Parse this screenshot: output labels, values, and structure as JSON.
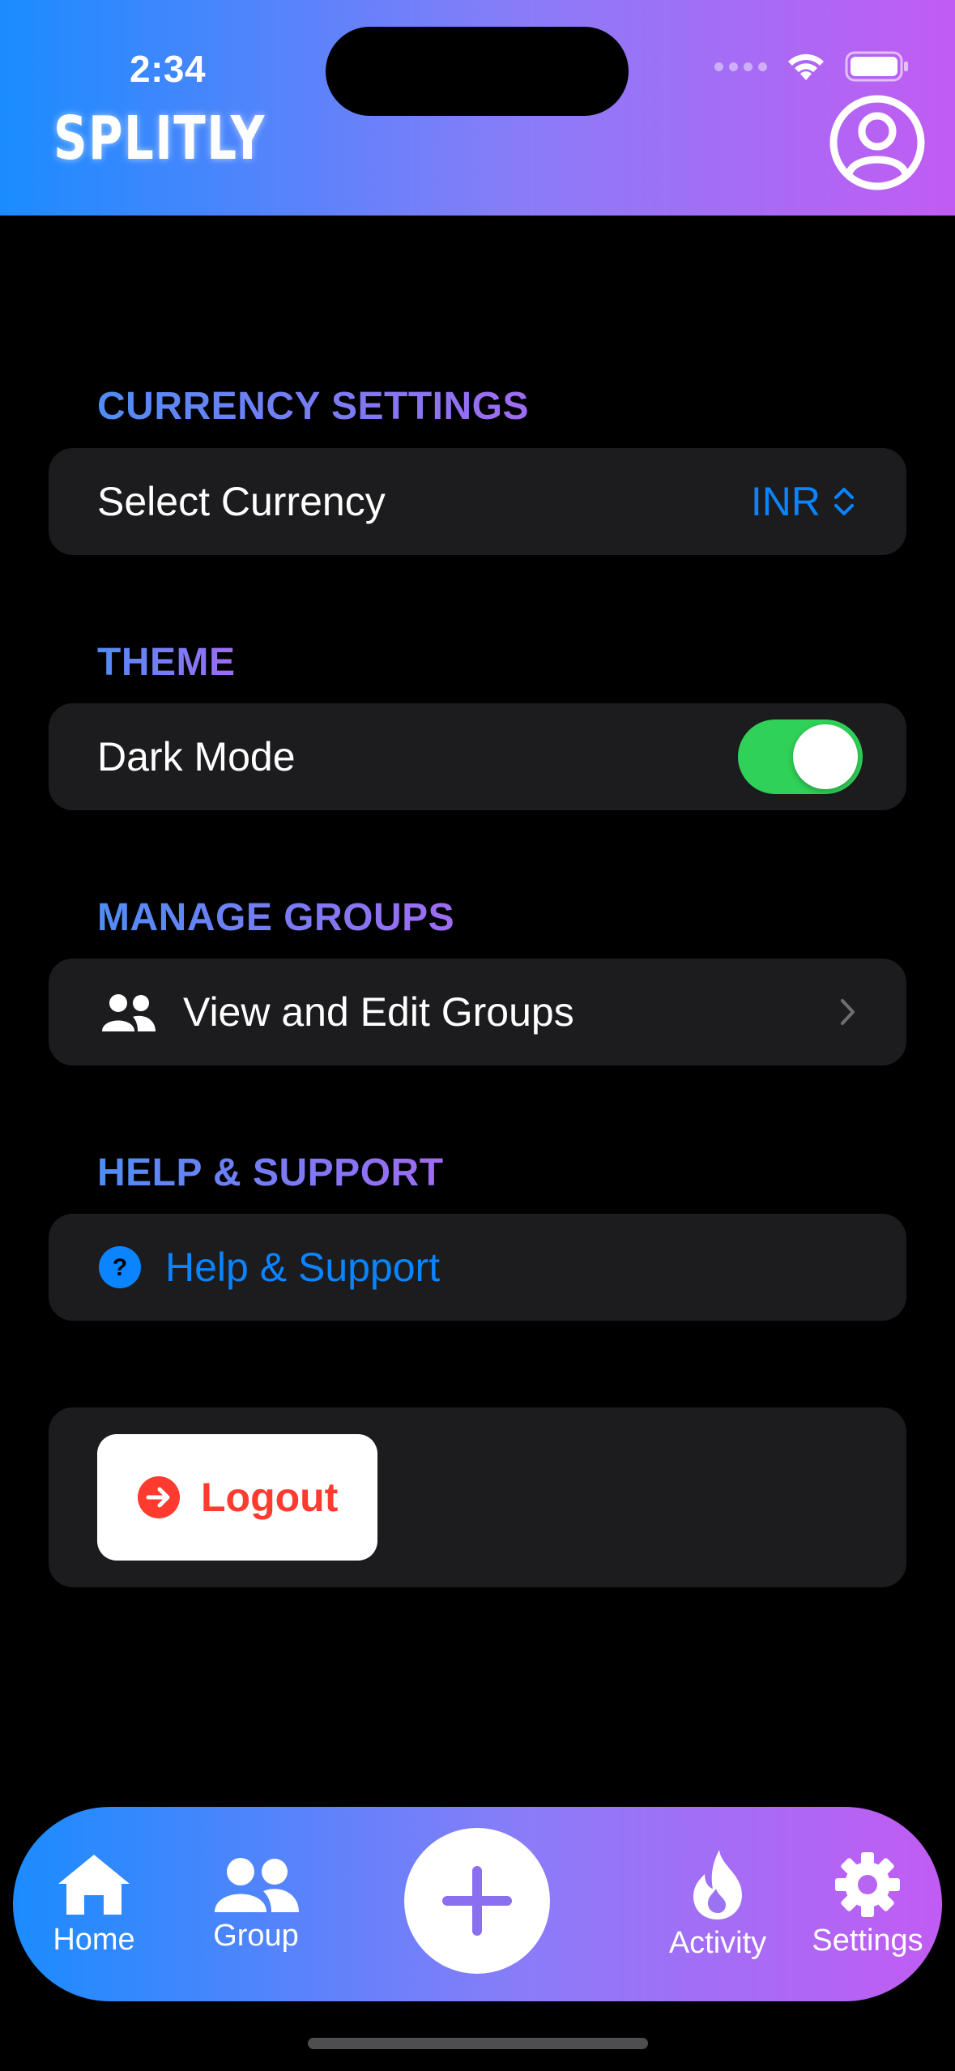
{
  "status_bar": {
    "time": "2:34"
  },
  "header": {
    "app_title": "SPLITLY",
    "profile_icon": "person-circle-icon"
  },
  "sections": {
    "currency": {
      "title": "CURRENCY SETTINGS",
      "row_label": "Select Currency",
      "selected_value": "INR",
      "icon": "chevron-up-down-icon"
    },
    "theme": {
      "title": "THEME",
      "row_label": "Dark Mode",
      "toggle_on": true
    },
    "groups": {
      "title": "MANAGE GROUPS",
      "row_label": "View and Edit Groups",
      "icon": "people-icon"
    },
    "help": {
      "title": "HELP & SUPPORT",
      "row_label": "Help & Support",
      "icon": "question-circle-icon"
    },
    "logout": {
      "label": "Logout",
      "icon": "arrow-right-circle-icon"
    }
  },
  "tabbar": {
    "items": [
      {
        "label": "Home",
        "icon": "house-icon"
      },
      {
        "label": "Group",
        "icon": "people-icon"
      },
      {
        "label": "",
        "icon": "plus-icon"
      },
      {
        "label": "Activity",
        "icon": "flame-icon"
      },
      {
        "label": "Settings",
        "icon": "gear-icon"
      }
    ]
  },
  "colors": {
    "gradient_start": "#1a8cff",
    "gradient_end": "#c15cf2",
    "accent_blue": "#0a84ff",
    "toggle_green": "#30d158",
    "logout_red": "#ff3b30",
    "card_bg": "#1c1c1e"
  }
}
